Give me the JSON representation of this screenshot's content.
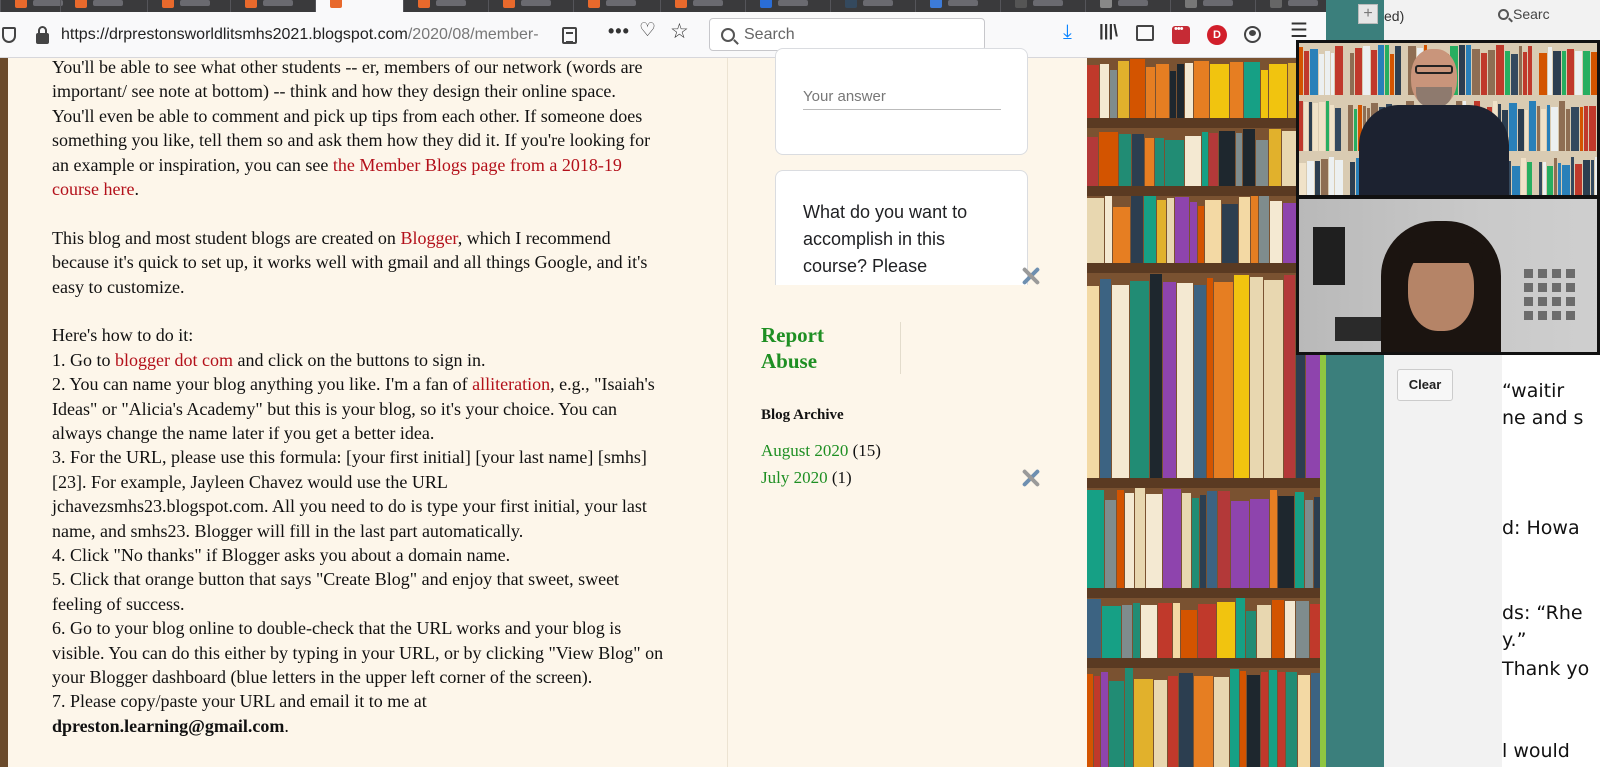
{
  "browser": {
    "url_main": "https://drprestonsworldlitsmhs2021.blogspot.com",
    "url_rest": "/2020/08/member-",
    "search_placeholder": "Search",
    "profile_letter": "D",
    "icons": [
      "shield-icon",
      "lock-icon",
      "reader-view-icon",
      "more-icon",
      "pocket-icon",
      "bookmark-star-icon",
      "search-icon",
      "download-icon",
      "library-icon",
      "sidebar-icon",
      "extension-icon",
      "profile-icon",
      "account-icon",
      "menu-icon"
    ]
  },
  "post": {
    "lines": [
      [
        {
          "t": "You'll be able to see what other students -- er, members of our network (words are"
        }
      ],
      [
        {
          "t": "important/ see note at bottom) -- think and how they design their online space."
        }
      ],
      [
        {
          "t": "You'll even be able to comment and pick up tips from each other. If someone does"
        }
      ],
      [
        {
          "t": "something you like, tell them so and ask them how they did it. If you're looking for"
        }
      ],
      [
        {
          "t": "an example or inspiration, you can see "
        },
        {
          "t": "the Member Blogs page from a 2018-19",
          "link": true
        }
      ],
      [
        {
          "t": "course here",
          "link": true
        },
        {
          "t": "."
        }
      ],
      [],
      [
        {
          "t": "This blog and most student blogs are created on "
        },
        {
          "t": "Blogger",
          "link": true
        },
        {
          "t": ", which I recommend"
        }
      ],
      [
        {
          "t": "because it's quick to set up, it works well with gmail and all things Google, and it's"
        }
      ],
      [
        {
          "t": "easy to customize."
        }
      ],
      [],
      [
        {
          "t": "Here's how to do it:"
        }
      ],
      [
        {
          "t": "1. Go to "
        },
        {
          "t": "blogger dot com",
          "link": true
        },
        {
          "t": " and click on the buttons to sign in."
        }
      ],
      [
        {
          "t": "2. You can name your blog anything you like. I'm a fan of "
        },
        {
          "t": "alliteration",
          "link": true
        },
        {
          "t": ", e.g., \"Isaiah's"
        }
      ],
      [
        {
          "t": "Ideas\" or \"Alicia's Academy\" but this is your blog, so it's your choice. You can"
        }
      ],
      [
        {
          "t": "always change the name later if you get a better idea."
        }
      ],
      [
        {
          "t": "3. For the URL, please use this formula: [your first initial] [your last name] [smhs]"
        }
      ],
      [
        {
          "t": "[23].  For example, Jayleen Chavez would use the URL"
        }
      ],
      [
        {
          "t": "jchavezsmhs23.blogspot.com. All you need to do is type your first initial, your last"
        }
      ],
      [
        {
          "t": "name, and smhs23. Blogger will fill in the last part automatically."
        }
      ],
      [
        {
          "t": "4. Click \"No thanks\" if Blogger asks you about a domain name."
        }
      ],
      [
        {
          "t": "5. Click that orange button that says \"Create Blog\" and enjoy that sweet, sweet"
        }
      ],
      [
        {
          "t": "feeling of success."
        }
      ],
      [
        {
          "t": "6. Go to your blog online to double-check that the URL works and your blog is"
        }
      ],
      [
        {
          "t": "visible. You can do this either by typing in your URL, or by clicking \"View Blog\" on"
        }
      ],
      [
        {
          "t": "your Blogger dashboard (blue letters in the upper left corner of the screen)."
        }
      ],
      [
        {
          "t": "7. Please copy/paste your URL and email it to me at"
        }
      ],
      [
        {
          "t": "dpreston.learning@gmail.com",
          "bold": true
        },
        {
          "t": "."
        }
      ]
    ]
  },
  "sidebar": {
    "answer_placeholder": "Your answer",
    "question": "What do you want to accomplish in this course? Please",
    "report_abuse": "Report Abuse",
    "archive_title": "Blog Archive",
    "archive": [
      {
        "label": "August 2020",
        "count": "(15)"
      },
      {
        "label": "July 2020",
        "count": "(1)"
      }
    ]
  },
  "doc_app": {
    "tab_text": "ed)",
    "search_label": "Searc",
    "clear_button": "Clear",
    "lines": [
      "“waitir",
      "ne and s",
      "d: Howa",
      "ds: “Rhe",
      "y.”",
      "Thank yo",
      "l would"
    ]
  },
  "colors": {
    "link_red": "#b3101a",
    "sidebar_green": "#1e8f23",
    "page_bg": "#fdf6ea",
    "teal_panel": "#3b7f7c"
  }
}
